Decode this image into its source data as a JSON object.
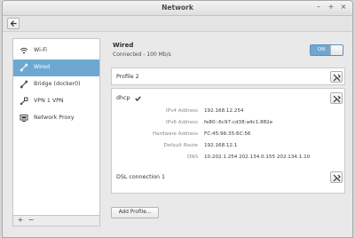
{
  "window": {
    "title": "Network",
    "controls": [
      "–",
      "+",
      "×"
    ]
  },
  "sidebar": {
    "items": [
      {
        "label": "Wi-Fi",
        "icon": "wifi-icon",
        "active": false
      },
      {
        "label": "Wired",
        "icon": "ethernet-icon",
        "active": true
      },
      {
        "label": "Bridge (docker0)",
        "icon": "ethernet-icon",
        "active": false
      },
      {
        "label": "VPN 1 VPN",
        "icon": "vpn-icon",
        "active": false
      },
      {
        "label": "Network Proxy",
        "icon": "proxy-icon",
        "active": false
      }
    ],
    "add_label": "+",
    "remove_label": "−"
  },
  "main": {
    "title": "Wired",
    "status": "Connected - 100 Mb/s",
    "toggle": {
      "label": "ON",
      "state": true
    },
    "profiles": [
      {
        "name": "Profile 2",
        "active": false
      },
      {
        "name": "dhcp",
        "active": true,
        "details": [
          {
            "key": "IPv4 Address",
            "value": "192.168.12.254"
          },
          {
            "key": "IPv6 Address",
            "value": "fe80::6c97:cd38:a4c1:882e"
          },
          {
            "key": "Hardware Address",
            "value": "FC:45:96:35:6C:56"
          },
          {
            "key": "Default Route",
            "value": "192.168.12.1"
          },
          {
            "key": "DNS",
            "value": "10.202.1.254 202.134.0.155 202.134.1.10"
          }
        ]
      },
      {
        "name": "DSL connection 1",
        "active": false
      }
    ],
    "add_profile_label": "Add Profile..."
  },
  "colors": {
    "accent": "#6ea8d2",
    "window_bg": "#e9e9e9"
  }
}
